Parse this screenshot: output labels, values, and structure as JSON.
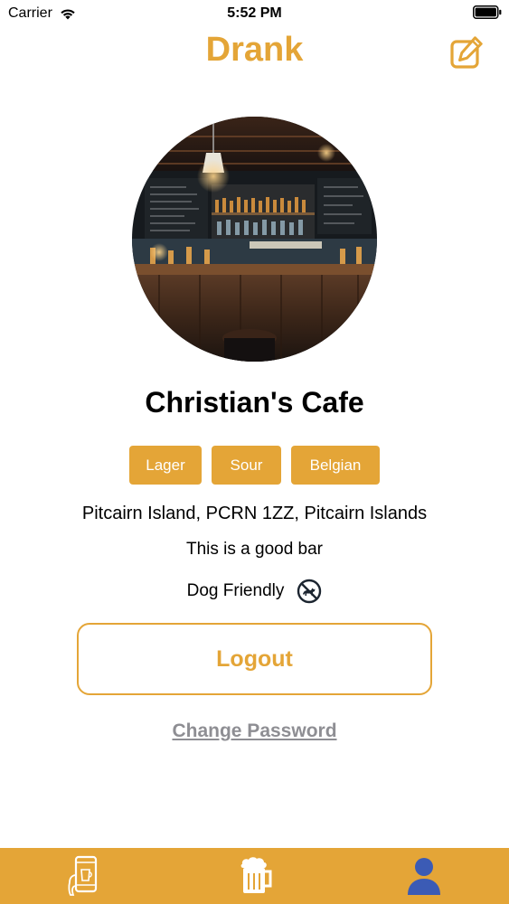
{
  "status_bar": {
    "carrier": "Carrier",
    "time": "5:52 PM",
    "wifi_icon": "wifi-icon",
    "battery_icon": "battery-icon"
  },
  "nav": {
    "title": "Drank",
    "edit_icon": "edit-icon"
  },
  "profile": {
    "photo": "bar-interior-photo",
    "name": "Christian's Cafe",
    "tags": [
      "Lager",
      "Sour",
      "Belgian"
    ],
    "address": "Pitcairn Island, PCRN 1ZZ, Pitcairn Islands",
    "description": "This is a good bar",
    "dog_friendly_label": "Dog Friendly",
    "dog_friendly_icon": "no-dogs-icon"
  },
  "actions": {
    "logout_label": "Logout",
    "change_password_label": "Change Password"
  },
  "tab_bar": {
    "items": [
      {
        "icon": "phone-beer-icon",
        "active": false
      },
      {
        "icon": "beer-mug-icon",
        "active": false
      },
      {
        "icon": "user-profile-icon",
        "active": true
      }
    ]
  },
  "colors": {
    "accent": "#e4a537",
    "active_tab": "#3b5bb5",
    "muted_text": "#8e8e93"
  }
}
